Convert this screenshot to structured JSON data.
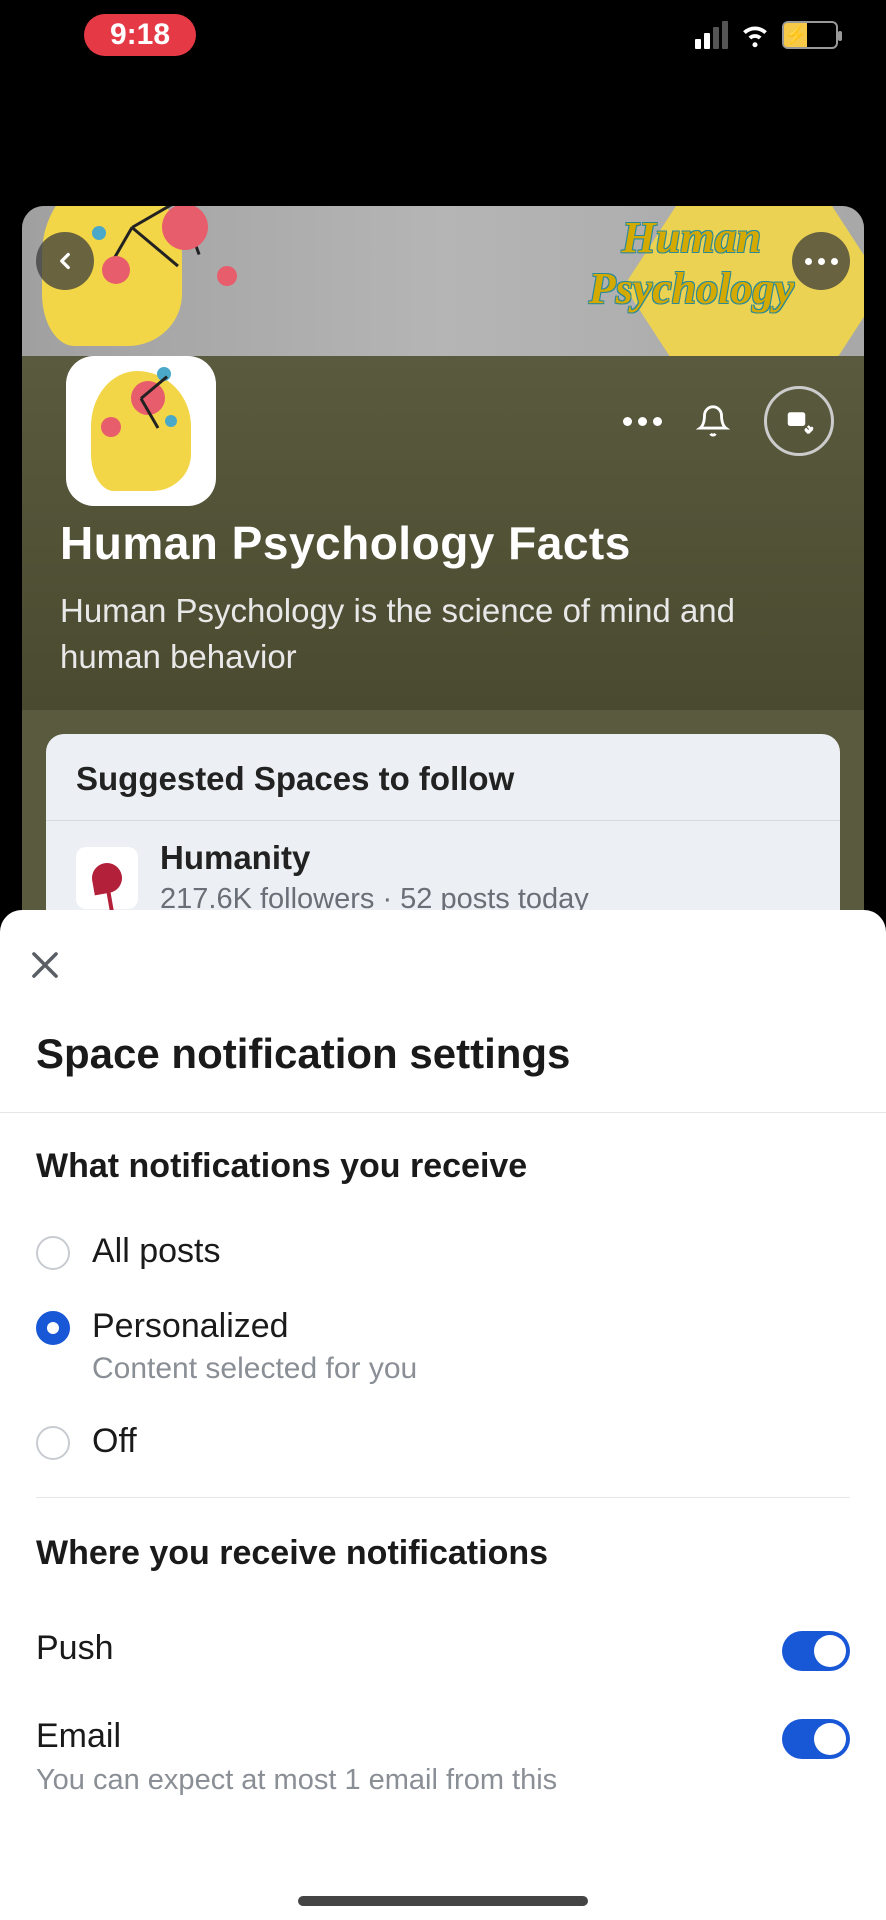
{
  "status": {
    "time": "9:18"
  },
  "space": {
    "cover_line1": "Human",
    "cover_line2": "Psychology",
    "title": "Human Psychology Facts",
    "description": "Human Psychology is the science of mind and human behavior"
  },
  "suggested": {
    "heading": "Suggested Spaces to follow",
    "items": [
      {
        "name": "Humanity",
        "meta": "217.6K followers · 52 posts today"
      }
    ]
  },
  "sheet": {
    "title": "Space notification settings",
    "section1": {
      "heading": "What notifications you receive",
      "options": {
        "all": "All posts",
        "personalized": "Personalized",
        "personalized_sub": "Content selected for you",
        "off": "Off"
      },
      "selected": "personalized"
    },
    "section2": {
      "heading": "Where you receive notifications",
      "push": {
        "label": "Push",
        "on": true
      },
      "email": {
        "label": "Email",
        "sub": "You can expect at most 1 email from this",
        "on": true
      }
    }
  }
}
